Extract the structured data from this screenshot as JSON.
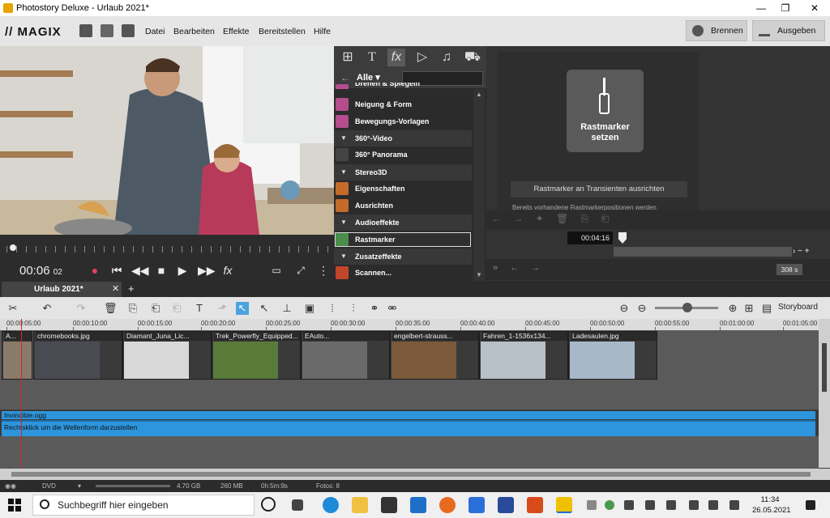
{
  "window": {
    "title": "Photostory Deluxe - Urlaub 2021*",
    "min": "—",
    "max": "❐",
    "close": "✕"
  },
  "menubar": {
    "brand": "MAGIX",
    "menus": [
      "Datei",
      "Bearbeiten",
      "Effekte",
      "Bereitstellen",
      "Hilfe"
    ],
    "burn_label": "Brennen",
    "output_label": "Ausgeben"
  },
  "transport": {
    "time": "00:06",
    "frames": "02",
    "fx": "fx"
  },
  "effects": {
    "filter_label": "Alle",
    "items": [
      {
        "label": "Drehen & Spiegeln",
        "type": "item",
        "color": "#b44c8e"
      },
      {
        "label": "Neigung & Form",
        "type": "item",
        "color": "#b44c8e"
      },
      {
        "label": "Bewegungs-Vorlagen",
        "type": "item",
        "color": "#b44c8e"
      },
      {
        "label": "360°-Video",
        "type": "cat"
      },
      {
        "label": "360° Panorama",
        "type": "item",
        "color": "#444"
      },
      {
        "label": "Stereo3D",
        "type": "cat"
      },
      {
        "label": "Eigenschaften",
        "type": "item",
        "color": "#c46a2a"
      },
      {
        "label": "Ausrichten",
        "type": "item",
        "color": "#c46a2a"
      },
      {
        "label": "Audioeffekte",
        "type": "cat"
      },
      {
        "label": "Rastmarker",
        "type": "item",
        "color": "#4b8d4b",
        "selected": true
      },
      {
        "label": "Zusatzeffekte",
        "type": "cat"
      },
      {
        "label": "Scannen...",
        "type": "item",
        "color": "#c4462a"
      }
    ]
  },
  "rastmarker": {
    "button_line1": "Rastmarker",
    "button_line2": "setzen",
    "align_label": "Rastmarker an Transienten ausrichten",
    "note": "Bereits vorhandene Rastmarkerpositionen werden",
    "timecode": "00:04:16",
    "seconds": "308 s"
  },
  "timeline": {
    "tab_label": "Urlaub 2021*",
    "storyboard_label": "Storyboard",
    "ruler": [
      "00:00:05:00",
      "00:00:10:00",
      "00:00:15:00",
      "00:00:20:00",
      "00:00:25:00",
      "00:00:30:00",
      "00:00:35:00",
      "00:00:40:00",
      "00:00:45:00",
      "00:00:50:00",
      "00:00:55:00",
      "00:01:00:00",
      "00:01:05:00"
    ],
    "clips": [
      {
        "name": "A...",
        "color": "#8a7a6a"
      },
      {
        "name": "chromebooks.jpg",
        "color": "#4a4a52"
      },
      {
        "name": "Diamant_Juna_Lic...",
        "color": "#d8d8d8"
      },
      {
        "name": "Trek_Powerfly_Equipped...",
        "color": "#5a7a3a"
      },
      {
        "name": "EAuto...",
        "color": "#6a6a6a"
      },
      {
        "name": "engelbert-strauss...",
        "color": "#7a5a3a"
      },
      {
        "name": "Fahren_1-1536x134...",
        "color": "#b8c0c8"
      },
      {
        "name": "Ladesaulen.jpg",
        "color": "#a8b8c8"
      }
    ],
    "audio_name": "Invincible.ogg",
    "audio_hint": "Rechtsklick um die Wellenform darzustellen"
  },
  "status": {
    "format": "DVD",
    "capacity": "4.70 GB",
    "size": "260 MB",
    "duration": "0h:5m:9s",
    "photos": "Fotos: 8"
  },
  "taskbar": {
    "search_placeholder": "Suchbegriff hier eingeben",
    "time": "11:34",
    "date": "26.05.2021"
  }
}
